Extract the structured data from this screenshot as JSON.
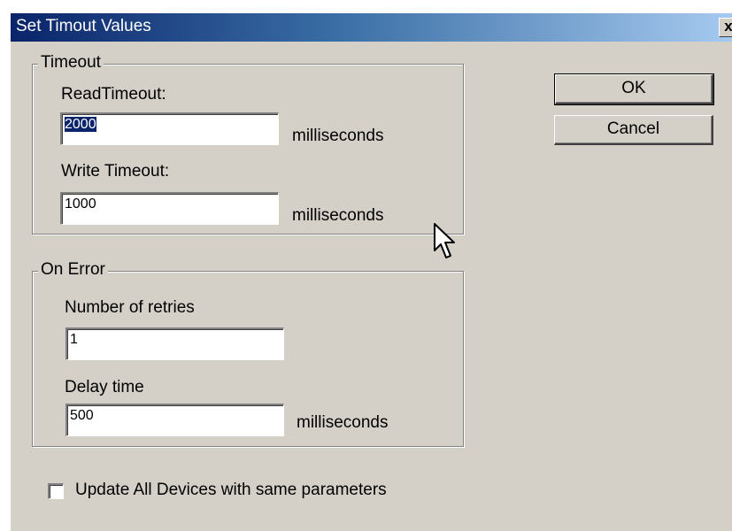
{
  "window": {
    "title": "Set Timout Values",
    "close_label": "x"
  },
  "timeout_group": {
    "legend": "Timeout",
    "read_label": "ReadTimeout:",
    "read_value": "2000",
    "read_unit": "milliseconds",
    "write_label": "Write Timeout:",
    "write_value": "1000",
    "write_unit": "milliseconds"
  },
  "error_group": {
    "legend": "On Error",
    "retries_label": "Number of retries",
    "retries_value": "1",
    "delay_label": "Delay time",
    "delay_value": "500",
    "delay_unit": "milliseconds"
  },
  "buttons": {
    "ok": "OK",
    "cancel": "Cancel"
  },
  "update_all": {
    "label": "Update All Devices with same parameters",
    "checked": false
  },
  "icons": {
    "cursor": "mouse-pointer-icon"
  },
  "colors": {
    "titlebar_start": "#0a246a",
    "titlebar_end": "#a6caf0",
    "face": "#d4d0c8",
    "selection": "#0a246a"
  }
}
